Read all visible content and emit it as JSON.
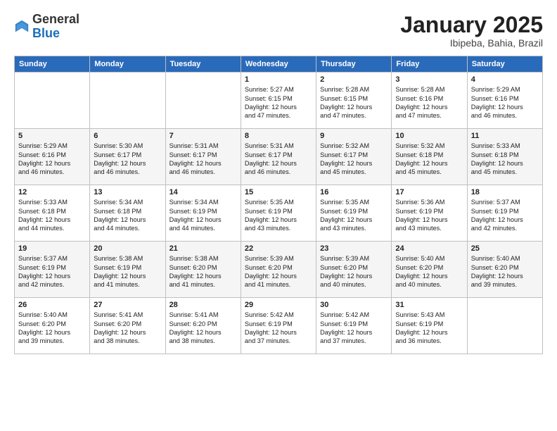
{
  "header": {
    "logo_general": "General",
    "logo_blue": "Blue",
    "month_title": "January 2025",
    "location": "Ibipeba, Bahia, Brazil"
  },
  "days_of_week": [
    "Sunday",
    "Monday",
    "Tuesday",
    "Wednesday",
    "Thursday",
    "Friday",
    "Saturday"
  ],
  "weeks": [
    [
      {
        "day": "",
        "info": ""
      },
      {
        "day": "",
        "info": ""
      },
      {
        "day": "",
        "info": ""
      },
      {
        "day": "1",
        "info": "Sunrise: 5:27 AM\nSunset: 6:15 PM\nDaylight: 12 hours\nand 47 minutes."
      },
      {
        "day": "2",
        "info": "Sunrise: 5:28 AM\nSunset: 6:15 PM\nDaylight: 12 hours\nand 47 minutes."
      },
      {
        "day": "3",
        "info": "Sunrise: 5:28 AM\nSunset: 6:16 PM\nDaylight: 12 hours\nand 47 minutes."
      },
      {
        "day": "4",
        "info": "Sunrise: 5:29 AM\nSunset: 6:16 PM\nDaylight: 12 hours\nand 46 minutes."
      }
    ],
    [
      {
        "day": "5",
        "info": "Sunrise: 5:29 AM\nSunset: 6:16 PM\nDaylight: 12 hours\nand 46 minutes."
      },
      {
        "day": "6",
        "info": "Sunrise: 5:30 AM\nSunset: 6:17 PM\nDaylight: 12 hours\nand 46 minutes."
      },
      {
        "day": "7",
        "info": "Sunrise: 5:31 AM\nSunset: 6:17 PM\nDaylight: 12 hours\nand 46 minutes."
      },
      {
        "day": "8",
        "info": "Sunrise: 5:31 AM\nSunset: 6:17 PM\nDaylight: 12 hours\nand 46 minutes."
      },
      {
        "day": "9",
        "info": "Sunrise: 5:32 AM\nSunset: 6:17 PM\nDaylight: 12 hours\nand 45 minutes."
      },
      {
        "day": "10",
        "info": "Sunrise: 5:32 AM\nSunset: 6:18 PM\nDaylight: 12 hours\nand 45 minutes."
      },
      {
        "day": "11",
        "info": "Sunrise: 5:33 AM\nSunset: 6:18 PM\nDaylight: 12 hours\nand 45 minutes."
      }
    ],
    [
      {
        "day": "12",
        "info": "Sunrise: 5:33 AM\nSunset: 6:18 PM\nDaylight: 12 hours\nand 44 minutes."
      },
      {
        "day": "13",
        "info": "Sunrise: 5:34 AM\nSunset: 6:18 PM\nDaylight: 12 hours\nand 44 minutes."
      },
      {
        "day": "14",
        "info": "Sunrise: 5:34 AM\nSunset: 6:19 PM\nDaylight: 12 hours\nand 44 minutes."
      },
      {
        "day": "15",
        "info": "Sunrise: 5:35 AM\nSunset: 6:19 PM\nDaylight: 12 hours\nand 43 minutes."
      },
      {
        "day": "16",
        "info": "Sunrise: 5:35 AM\nSunset: 6:19 PM\nDaylight: 12 hours\nand 43 minutes."
      },
      {
        "day": "17",
        "info": "Sunrise: 5:36 AM\nSunset: 6:19 PM\nDaylight: 12 hours\nand 43 minutes."
      },
      {
        "day": "18",
        "info": "Sunrise: 5:37 AM\nSunset: 6:19 PM\nDaylight: 12 hours\nand 42 minutes."
      }
    ],
    [
      {
        "day": "19",
        "info": "Sunrise: 5:37 AM\nSunset: 6:19 PM\nDaylight: 12 hours\nand 42 minutes."
      },
      {
        "day": "20",
        "info": "Sunrise: 5:38 AM\nSunset: 6:19 PM\nDaylight: 12 hours\nand 41 minutes."
      },
      {
        "day": "21",
        "info": "Sunrise: 5:38 AM\nSunset: 6:20 PM\nDaylight: 12 hours\nand 41 minutes."
      },
      {
        "day": "22",
        "info": "Sunrise: 5:39 AM\nSunset: 6:20 PM\nDaylight: 12 hours\nand 41 minutes."
      },
      {
        "day": "23",
        "info": "Sunrise: 5:39 AM\nSunset: 6:20 PM\nDaylight: 12 hours\nand 40 minutes."
      },
      {
        "day": "24",
        "info": "Sunrise: 5:40 AM\nSunset: 6:20 PM\nDaylight: 12 hours\nand 40 minutes."
      },
      {
        "day": "25",
        "info": "Sunrise: 5:40 AM\nSunset: 6:20 PM\nDaylight: 12 hours\nand 39 minutes."
      }
    ],
    [
      {
        "day": "26",
        "info": "Sunrise: 5:40 AM\nSunset: 6:20 PM\nDaylight: 12 hours\nand 39 minutes."
      },
      {
        "day": "27",
        "info": "Sunrise: 5:41 AM\nSunset: 6:20 PM\nDaylight: 12 hours\nand 38 minutes."
      },
      {
        "day": "28",
        "info": "Sunrise: 5:41 AM\nSunset: 6:20 PM\nDaylight: 12 hours\nand 38 minutes."
      },
      {
        "day": "29",
        "info": "Sunrise: 5:42 AM\nSunset: 6:19 PM\nDaylight: 12 hours\nand 37 minutes."
      },
      {
        "day": "30",
        "info": "Sunrise: 5:42 AM\nSunset: 6:19 PM\nDaylight: 12 hours\nand 37 minutes."
      },
      {
        "day": "31",
        "info": "Sunrise: 5:43 AM\nSunset: 6:19 PM\nDaylight: 12 hours\nand 36 minutes."
      },
      {
        "day": "",
        "info": ""
      }
    ]
  ]
}
